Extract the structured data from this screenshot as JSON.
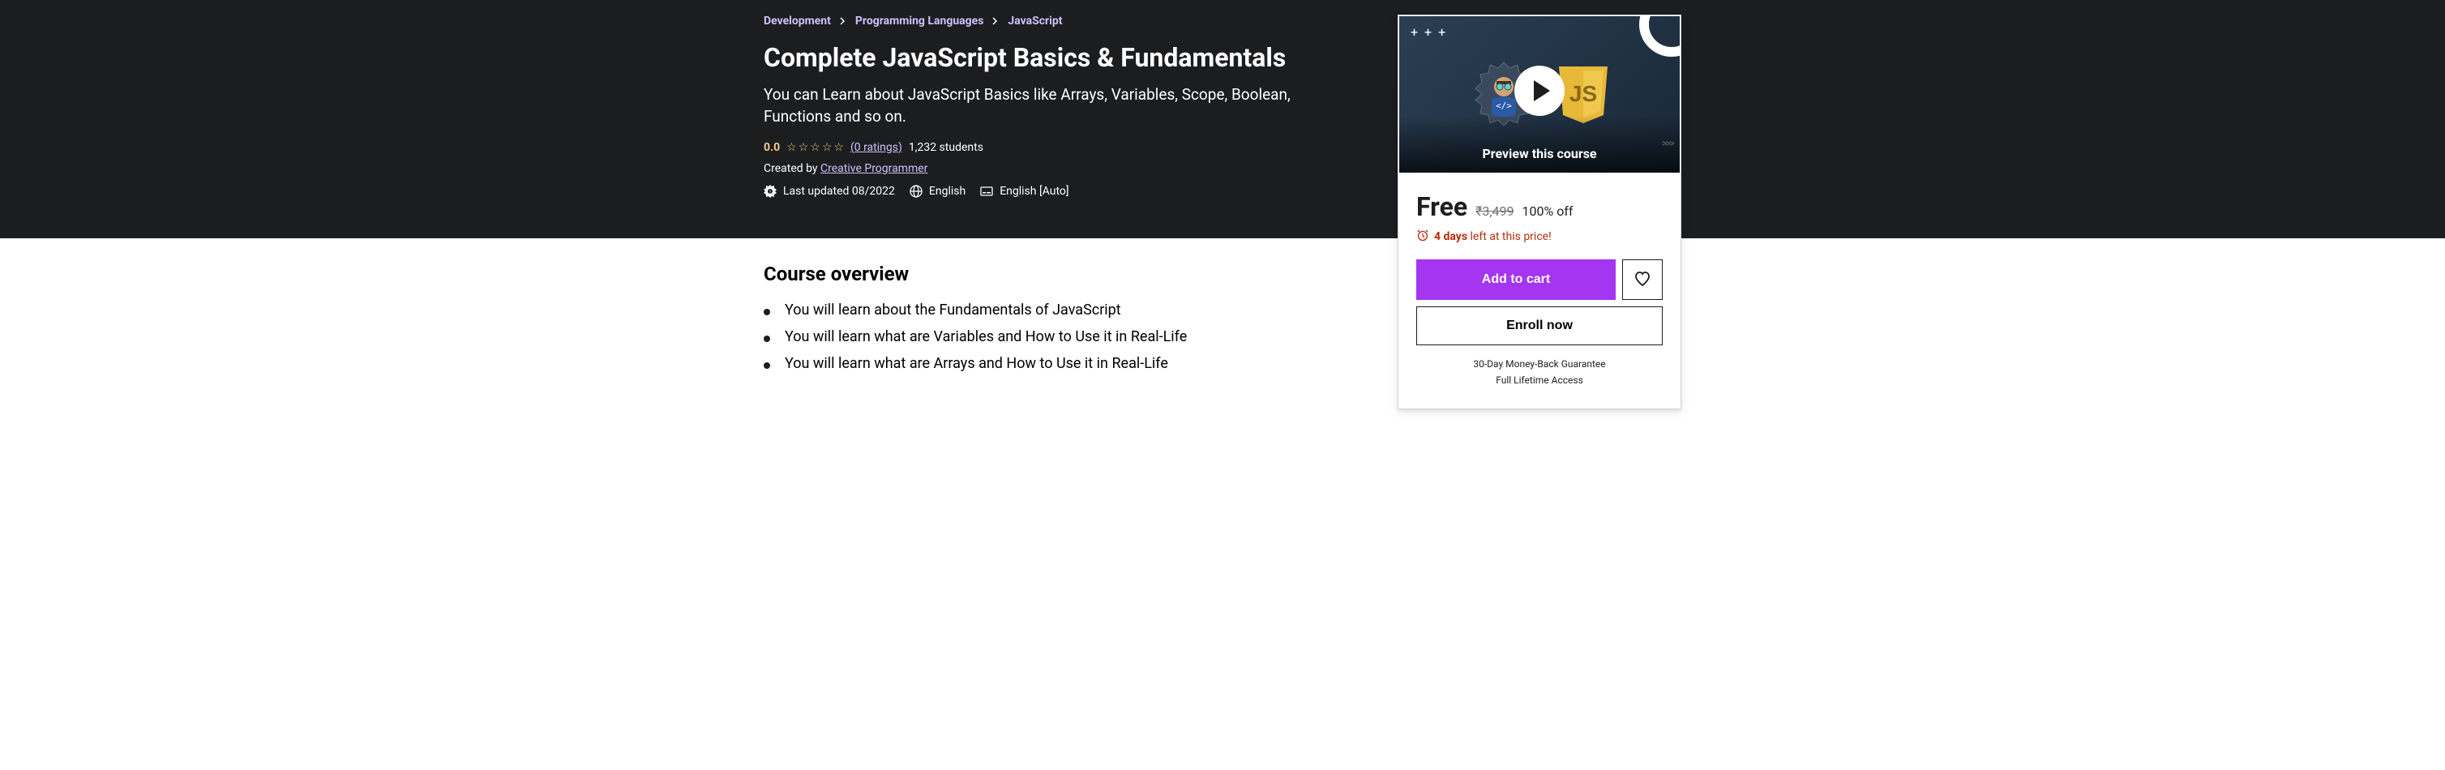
{
  "breadcrumb": {
    "items": [
      "Development",
      "Programming Languages",
      "JavaScript"
    ]
  },
  "course": {
    "title": "Complete JavaScript Basics & Fundamentals",
    "subtitle": "You can Learn about JavaScript Basics like Arrays, Variables, Scope, Boolean, Functions and so on.",
    "rating_value": "0.0",
    "ratings_link": "(0 ratings)",
    "students": "1,232 students",
    "created_by_prefix": "Created by ",
    "creator": "Creative Programmer",
    "last_updated": "Last updated 08/2022",
    "language": "English",
    "captions": "English [Auto]"
  },
  "sidebar": {
    "preview_label": "Preview this course",
    "price_free": "Free",
    "price_original": "₹3,499",
    "price_discount": "100% off",
    "urgency_bold": "4 days",
    "urgency_rest": " left at this price!",
    "add_to_cart": "Add to cart",
    "enroll": "Enroll now",
    "guarantee": "30-Day Money-Back Guarantee",
    "lifetime": "Full Lifetime Access"
  },
  "overview": {
    "title": "Course overview",
    "items": [
      "You will learn about the Fundamentals of JavaScript",
      "You will learn what are Variables and How to Use it in Real-Life",
      "You will learn what are Arrays and How to Use it in Real-Life"
    ]
  }
}
